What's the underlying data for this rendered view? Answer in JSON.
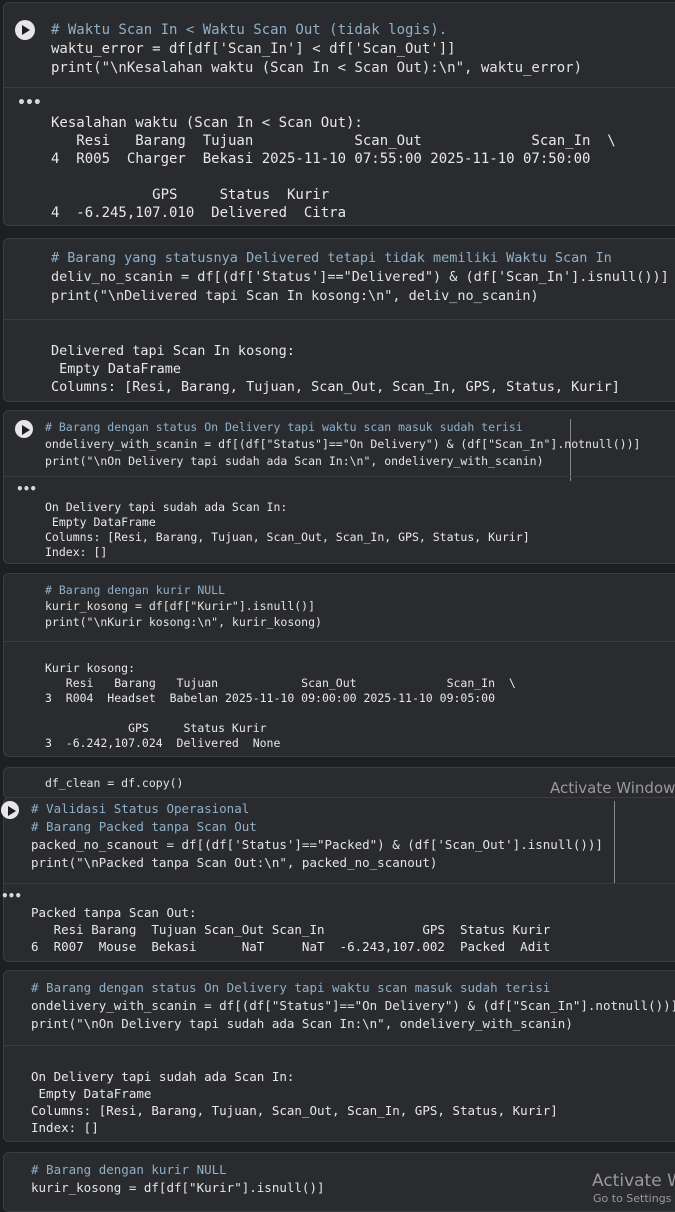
{
  "cells": [
    {
      "id": "cell-1",
      "code": [
        "# Waktu Scan In < Waktu Scan Out (tidak logis).",
        "waktu_error = df[df['Scan_In'] < df['Scan_Out']]",
        "print(\"\\nKesalahan waktu (Scan In < Scan Out):\\n\", waktu_error)"
      ],
      "output": [
        "Kesalahan waktu (Scan In < Scan Out):",
        "   Resi   Barang  Tujuan            Scan_Out             Scan_In  \\",
        "4  R005  Charger  Bekasi 2025-11-10 07:55:00 2025-11-10 07:50:00",
        "",
        "            GPS     Status  Kurir",
        "4  -6.245,107.010  Delivered  Citra"
      ]
    },
    {
      "id": "cell-2",
      "code": [
        "# Barang yang statusnya Delivered tetapi tidak memiliki Waktu Scan In",
        "deliv_no_scanin = df[(df['Status']==\"Delivered\") & (df['Scan_In'].isnull())]",
        "print(\"\\nDelivered tapi Scan In kosong:\\n\", deliv_no_scanin)"
      ],
      "output": [
        "Delivered tapi Scan In kosong:",
        " Empty DataFrame",
        "Columns: [Resi, Barang, Tujuan, Scan_Out, Scan_In, GPS, Status, Kurir]"
      ]
    },
    {
      "id": "cell-3",
      "code": [
        "# Barang dengan status On Delivery tapi waktu scan masuk sudah terisi",
        "ondelivery_with_scanin = df[(df[\"Status\"]==\"On Delivery\") & (df[\"Scan_In\"].notnull())]",
        "print(\"\\nOn Delivery tapi sudah ada Scan In:\\n\", ondelivery_with_scanin)"
      ],
      "output": [
        "On Delivery tapi sudah ada Scan In:",
        " Empty DataFrame",
        "Columns: [Resi, Barang, Tujuan, Scan_Out, Scan_In, GPS, Status, Kurir]",
        "Index: []"
      ]
    },
    {
      "id": "cell-4",
      "code": [
        "# Barang dengan kurir NULL",
        "kurir_kosong = df[df[\"Kurir\"].isnull()]",
        "print(\"\\nKurir kosong:\\n\", kurir_kosong)"
      ],
      "output": [
        "Kurir kosong:",
        "   Resi   Barang   Tujuan            Scan_Out             Scan_In  \\",
        "3  R004  Headset  Babelan 2025-11-10 09:00:00 2025-11-10 09:05:00",
        "",
        "            GPS     Status Kurir",
        "3  -6.242,107.024  Delivered  None"
      ]
    },
    {
      "id": "cell-5",
      "code": [
        "df_clean = df.copy()"
      ],
      "output": []
    },
    {
      "id": "cell-6",
      "code": [
        "# Validasi Status Operasional",
        "# Barang Packed tanpa Scan Out",
        "packed_no_scanout = df[(df['Status']==\"Packed\") & (df['Scan_Out'].isnull())]",
        "print(\"\\nPacked tanpa Scan Out:\\n\", packed_no_scanout)"
      ],
      "output": [
        "Packed tanpa Scan Out:",
        "   Resi Barang  Tujuan Scan_Out Scan_In             GPS  Status Kurir",
        "6  R007  Mouse  Bekasi      NaT     NaT  -6.243,107.002  Packed  Adit"
      ]
    },
    {
      "id": "cell-7",
      "code": [
        "# Barang dengan status On Delivery tapi waktu scan masuk sudah terisi",
        "ondelivery_with_scanin = df[(df[\"Status\"]==\"On Delivery\") & (df[\"Scan_In\"].notnull())]",
        "print(\"\\nOn Delivery tapi sudah ada Scan In:\\n\", ondelivery_with_scanin)"
      ],
      "output": [
        "On Delivery tapi sudah ada Scan In:",
        " Empty DataFrame",
        "Columns: [Resi, Barang, Tujuan, Scan_Out, Scan_In, GPS, Status, Kurir]",
        "Index: []"
      ]
    },
    {
      "id": "cell-8",
      "code": [
        "# Barang dengan kurir NULL",
        "kurir_kosong = df[df[\"Kurir\"].isnull()]"
      ],
      "output": []
    }
  ],
  "watermark": {
    "line1": "Activate Windows",
    "line2": "Activate W",
    "line3": "Go to Settings"
  },
  "icons": {
    "run": "run-cell-icon",
    "more": "output-more-icon"
  },
  "colors": {
    "background": "#1e1f22",
    "cell": "#2a2b2e",
    "comment": "#8fb0c9",
    "string": "#ce9178"
  }
}
